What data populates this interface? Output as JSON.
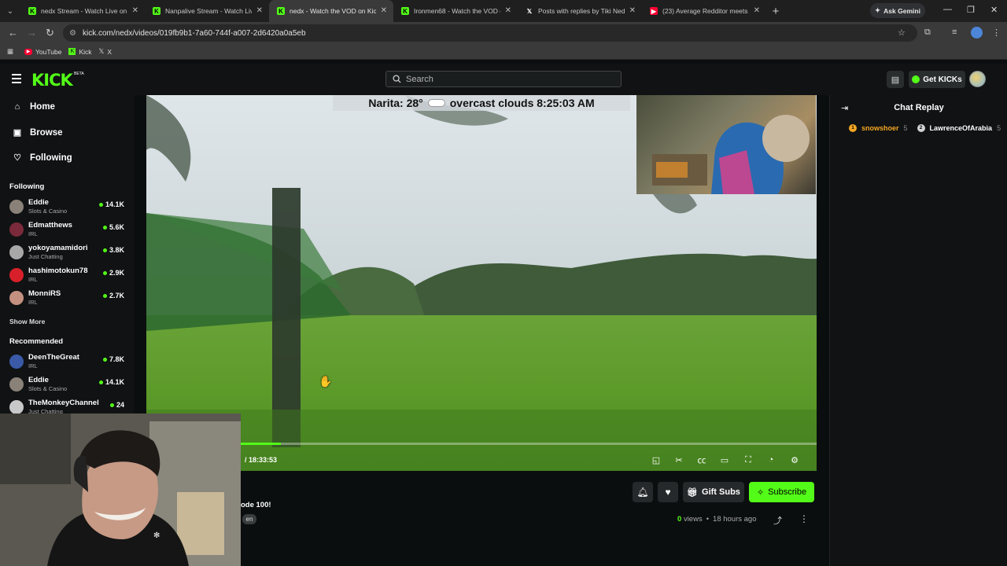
{
  "browser": {
    "tabs": [
      {
        "title": "nedx Stream - Watch Live on Ki",
        "icon": "kick",
        "active": false
      },
      {
        "title": "Nanpalive Stream - Watch Live",
        "icon": "kick",
        "active": false
      },
      {
        "title": "nedx - Watch the VOD on Kick",
        "icon": "kick",
        "active": true
      },
      {
        "title": "Ironmen68 - Watch the VOD o",
        "icon": "kick",
        "active": false
      },
      {
        "title": "Posts with replies by Tiki NedX",
        "icon": "x",
        "active": false
      },
      {
        "title": "(23) Average Redditor meets a",
        "icon": "youtube",
        "active": false
      }
    ],
    "ask_gemini": "Ask Gemini",
    "url": "kick.com/nedx/videos/019fb9b1-7a60-744f-a007-2d6420a0a5eb",
    "bookmarks": [
      {
        "label": "YouTube",
        "icon": "youtube"
      },
      {
        "label": "Kick",
        "icon": "kick"
      },
      {
        "label": "X",
        "icon": "x"
      }
    ]
  },
  "header": {
    "logo": "KICK",
    "beta": "BETA",
    "search_placeholder": "Search",
    "get_kicks": "Get KICKs"
  },
  "sidebar": {
    "nav": [
      {
        "label": "Home",
        "icon": "home-icon"
      },
      {
        "label": "Browse",
        "icon": "browse-icon"
      },
      {
        "label": "Following",
        "icon": "heart-icon"
      }
    ],
    "following_title": "Following",
    "following": [
      {
        "name": "Eddie",
        "category": "Slots & Casino",
        "viewers": "14.1K",
        "avatar_color": "#8a8178"
      },
      {
        "name": "Edmatthews",
        "category": "IRL",
        "viewers": "5.6K",
        "avatar_color": "#7a2a3a"
      },
      {
        "name": "yokoyamamidori",
        "category": "Just Chatting",
        "viewers": "3.8K",
        "avatar_color": "#a8a8a8"
      },
      {
        "name": "hashimotokun78",
        "category": "IRL",
        "viewers": "2.9K",
        "avatar_color": "#d8202a"
      },
      {
        "name": "MonniRS",
        "category": "IRL",
        "viewers": "2.7K",
        "avatar_color": "#c49080"
      }
    ],
    "show_more": "Show More",
    "recommended_title": "Recommended",
    "recommended": [
      {
        "name": "DeenTheGreat",
        "category": "IRL",
        "viewers": "7.8K",
        "avatar_color": "#3a5aa8"
      },
      {
        "name": "Eddie",
        "category": "Slots & Casino",
        "viewers": "14.1K",
        "avatar_color": "#8a8178"
      },
      {
        "name": "TheMonkeyChannel",
        "category": "Just Chatting",
        "viewers": "24",
        "avatar_color": "#c8c8c8"
      }
    ]
  },
  "video": {
    "weather_overlay": "Narita: 28°        overcast clouds 8:25:03 AM",
    "weather_left": "Narita: 28°",
    "weather_right": "overcast clouds 8:25:03 AM",
    "timecode": "/ 18:33:53",
    "progress_fraction": 0.07
  },
  "below_video": {
    "title_fragment": "ode 100!",
    "language": "en",
    "gift_subs": "Gift Subs",
    "subscribe": "Subscribe",
    "views_count": "0",
    "views_label": "views",
    "separator": "•",
    "posted": "18 hours ago"
  },
  "chat": {
    "title": "Chat Replay",
    "users": [
      {
        "name": "snowshoer",
        "badge_number": "5",
        "badge_color": "#f5a623",
        "name_color": "#f5a623"
      },
      {
        "name": "LawrenceOfArabia",
        "badge_number": "5",
        "badge_color": "#cfd3d6",
        "name_color": "#ffffff"
      }
    ]
  },
  "colors": {
    "accent": "#53fc18",
    "background": "#0b0e0f",
    "panel": "#101213"
  }
}
